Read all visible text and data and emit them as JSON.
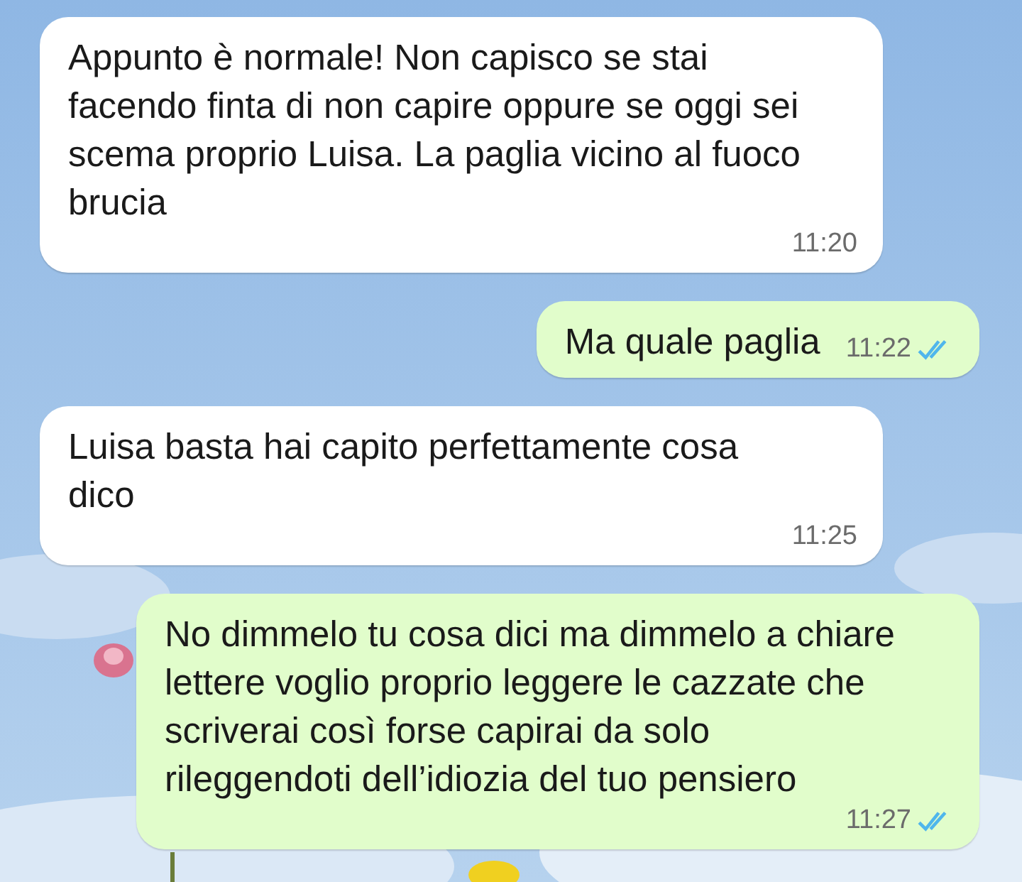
{
  "messages": [
    {
      "kind": "incoming",
      "text": "Appunto è normale! Non capisco se stai facendo finta di non capire oppure se oggi sei scema proprio Luisa. La paglia vicino al fuoco brucia",
      "time": "11:20"
    },
    {
      "kind": "outgoing",
      "text": "Ma quale paglia",
      "time": "11:22",
      "read": true
    },
    {
      "kind": "incoming",
      "text": "Luisa basta hai capito perfettamente cosa dico",
      "time": "11:25"
    },
    {
      "kind": "outgoing",
      "text": "No dimmelo tu cosa dici ma dimmelo a chiare lettere voglio proprio leggere le cazzate che scriverai così forse capirai da solo rileggendoti dell’idiozia del tuo pensiero",
      "time": "11:27",
      "read": true
    }
  ]
}
